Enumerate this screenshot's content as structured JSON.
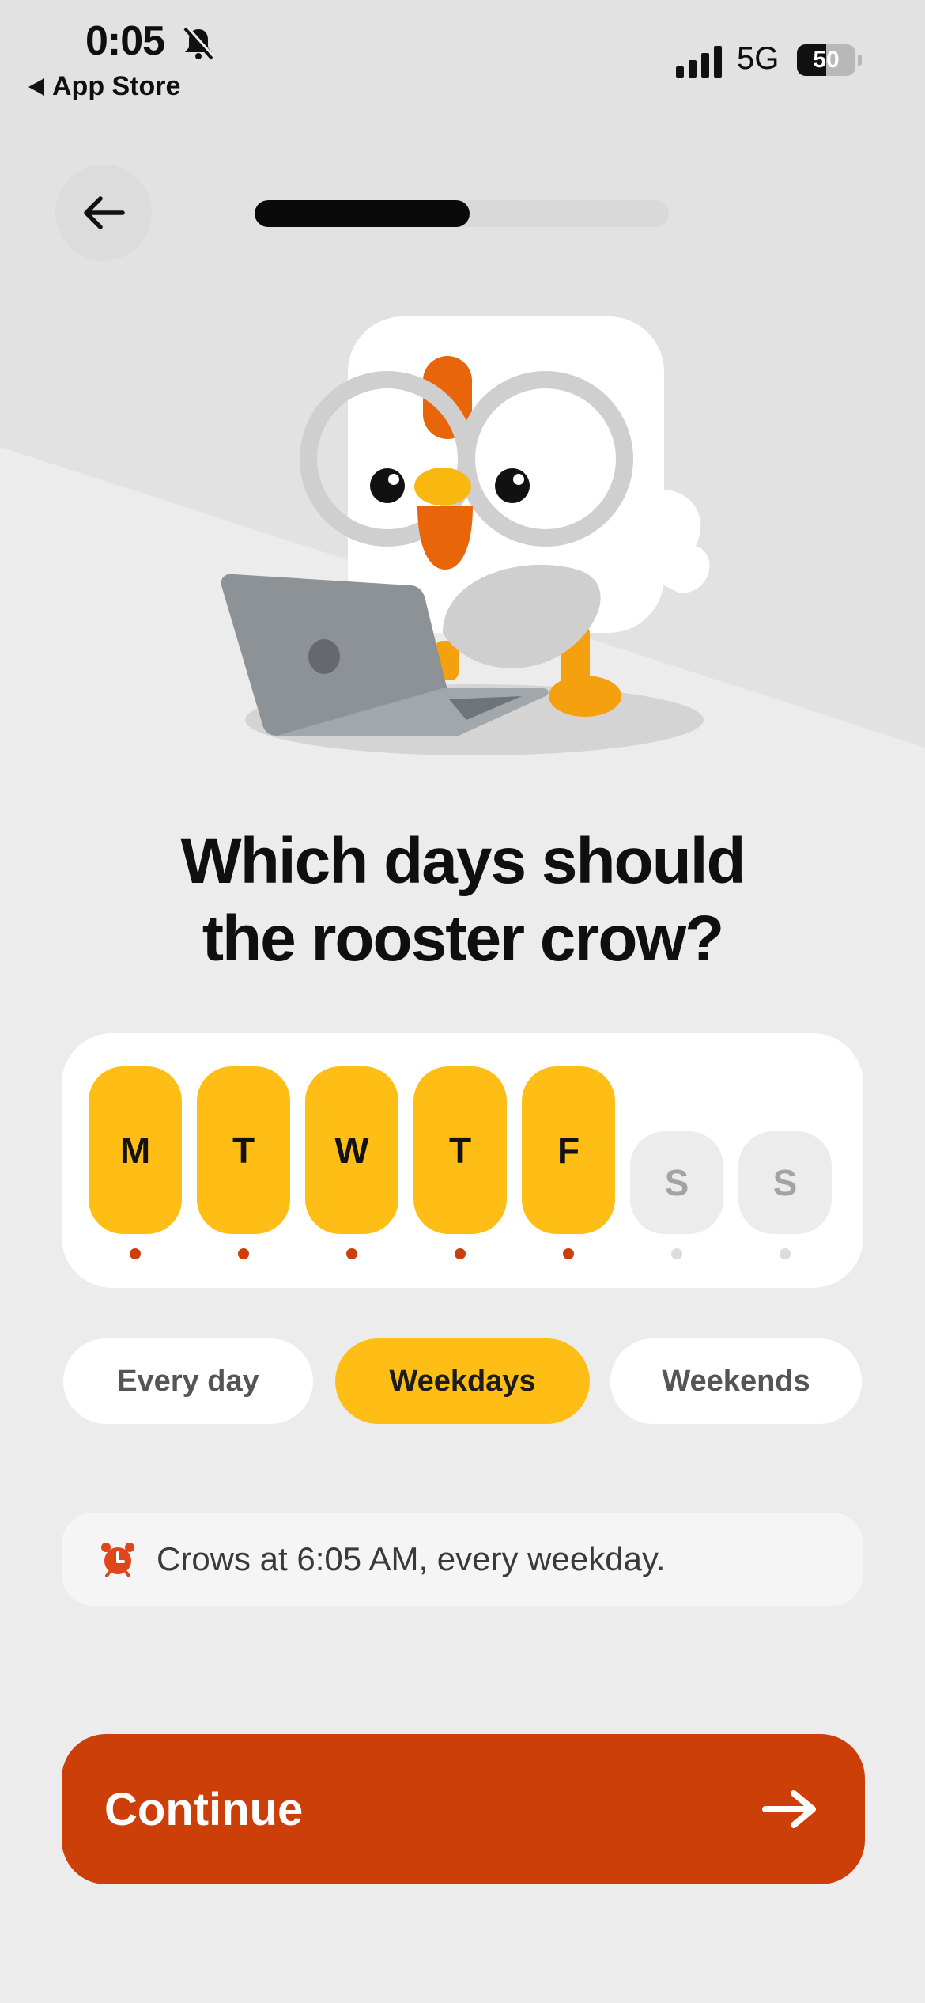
{
  "status_bar": {
    "time": "0:05",
    "back_app": "App Store",
    "network": "5G",
    "battery": "50"
  },
  "onboarding": {
    "progress": 0.52
  },
  "question": {
    "line1": "Which days should",
    "line2": "the rooster crow?"
  },
  "days": [
    {
      "label": "M",
      "selected": true
    },
    {
      "label": "T",
      "selected": true
    },
    {
      "label": "W",
      "selected": true
    },
    {
      "label": "T",
      "selected": true
    },
    {
      "label": "F",
      "selected": true
    },
    {
      "label": "S",
      "selected": false
    },
    {
      "label": "S",
      "selected": false
    }
  ],
  "presets": {
    "every_day": "Every day",
    "weekdays": "Weekdays",
    "weekends": "Weekends",
    "active": "weekdays"
  },
  "summary": {
    "text": "Crows at 6:05 AM, every weekday.",
    "icon": "alarm-clock-icon"
  },
  "continue": {
    "label": "Continue",
    "icon": "arrow-right-icon"
  },
  "colors": {
    "accent_yellow": "#ffbe16",
    "accent_orange": "#cc3f08",
    "background": "#ececec"
  }
}
